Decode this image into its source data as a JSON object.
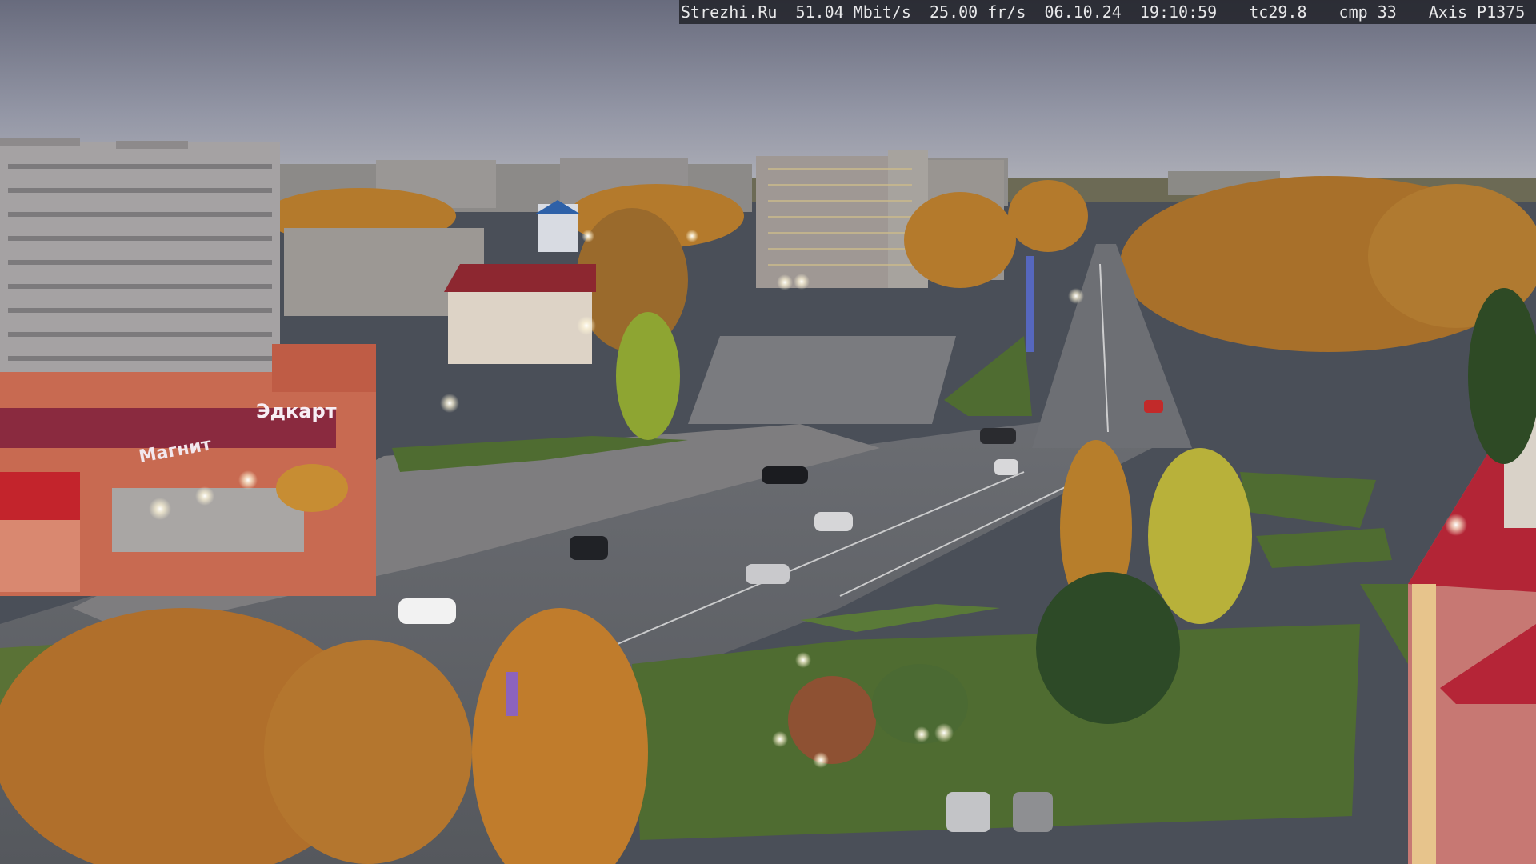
{
  "overlay": {
    "site": "Strezhi.Ru",
    "bitrate": "51.04 Mbit/s",
    "fps": "25.00 fr/s",
    "date": "06.10.24",
    "time": "19:10:59",
    "tc": "tc29.8",
    "cmp": "cmp 33",
    "camera": "Axis P1375"
  },
  "signage": {
    "store_left": "Магнит",
    "store_right": "Эдкарт"
  },
  "colors": {
    "sky_top": "#6e7182",
    "sky_bottom": "#a7aab6",
    "foliage": "#b5762b",
    "road": "#5b5e63",
    "grass": "#4e6e2f"
  }
}
